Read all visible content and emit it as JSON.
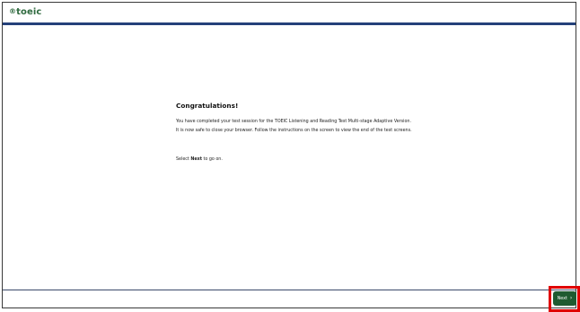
{
  "header": {
    "logo_mark": "®",
    "logo_text": "toeic"
  },
  "main": {
    "title": "Congratulations!",
    "paragraph_1": "You have completed your test session for the TOEIC Listening and Reading Test Multi-stage Adaptive Version.",
    "paragraph_2": "It is now safe to close your browser. Follow the instructions on the screen to view the end of the test screens.",
    "select_prefix": "Select ",
    "select_bold": "Next",
    "select_suffix": " to go on."
  },
  "footer": {
    "next_label": "Next",
    "next_icon": "chevron-right-icon",
    "next_glyph": "›"
  },
  "colors": {
    "brand_green": "#2f6a3f",
    "header_bar": "#24407a",
    "button_bg": "#1f5a30",
    "highlight": "#e00000"
  }
}
